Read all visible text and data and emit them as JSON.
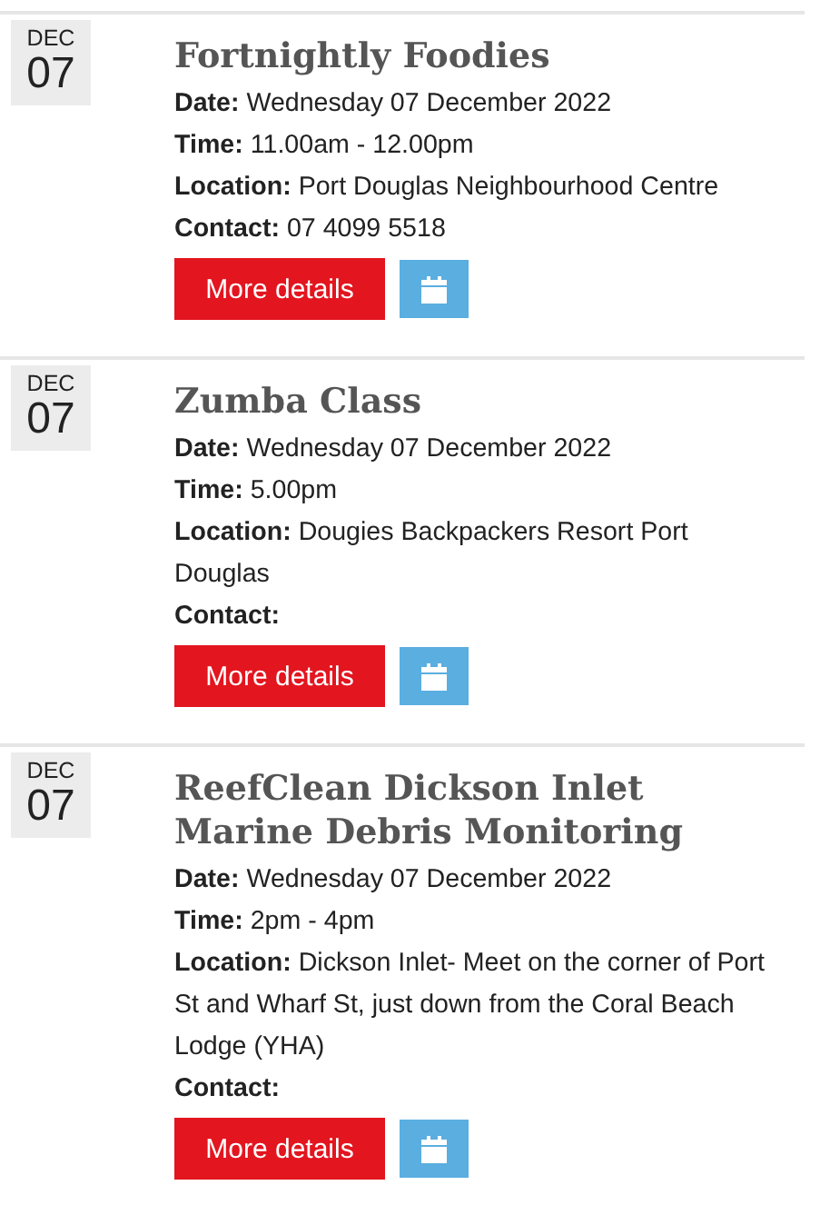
{
  "events": [
    {
      "month": "DEC",
      "day": "07",
      "title": "Fortnightly Foodies",
      "details": [
        {
          "label": "Date:",
          "value": "Wednesday 07 December 2022"
        },
        {
          "label": "Time:",
          "value": "11.00am - 12.00pm"
        },
        {
          "label": "Location:",
          "value": "Port Douglas Neighbourhood Centre"
        },
        {
          "label": "Contact:",
          "value": "07 4099 5518"
        }
      ],
      "button": "More details"
    },
    {
      "month": "DEC",
      "day": "07",
      "title": "Zumba Class",
      "details": [
        {
          "label": "Date:",
          "value": "Wednesday 07 December 2022"
        },
        {
          "label": "Time:",
          "value": "5.00pm"
        },
        {
          "label": "Location:",
          "value": "Dougies Backpackers Resort Port Douglas"
        },
        {
          "label": "Contact:"
        }
      ],
      "button": "More details"
    },
    {
      "month": "DEC",
      "day": "07",
      "title": "ReefClean Dickson Inlet Marine Debris Monitoring",
      "details": [
        {
          "label": "Date:",
          "value": "Wednesday 07 December 2022"
        },
        {
          "label": "Time:",
          "value": "2pm - 4pm"
        },
        {
          "label": "Location:",
          "value": "Dickson Inlet- Meet on the corner of Port St and Wharf St, just down from the Coral Beach Lodge (YHA)"
        },
        {
          "label": "Contact:"
        }
      ],
      "button": "More details"
    }
  ]
}
